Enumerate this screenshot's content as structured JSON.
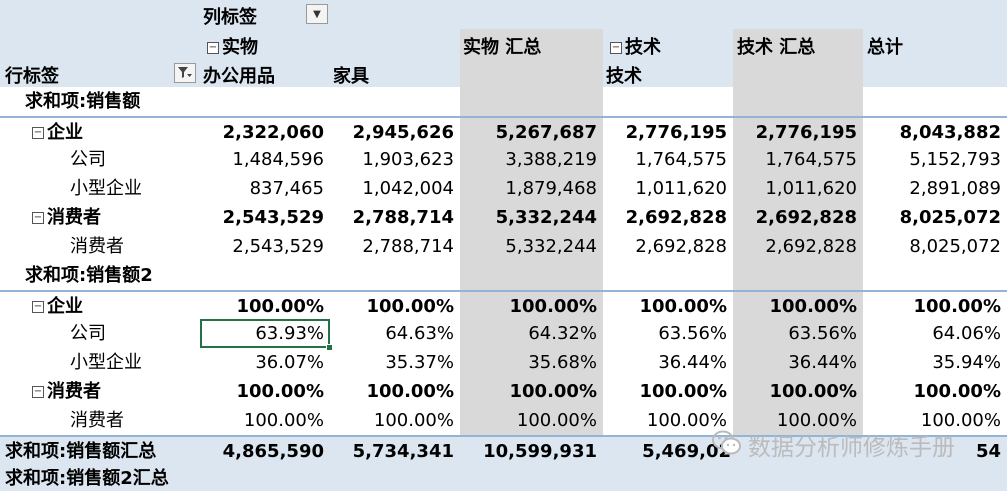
{
  "header": {
    "column_labels": "列标签",
    "row_labels": "行标签",
    "group_physical": "实物",
    "office": "办公用品",
    "furniture": "家具",
    "physical_total": "实物 汇总",
    "group_tech": "技术",
    "tech": "技术",
    "tech_total": "技术 汇总",
    "grand_total": "总计"
  },
  "section1": {
    "title": "求和项:销售额",
    "rows": [
      {
        "label": "企业",
        "level": 1,
        "collapse": true,
        "bold": true,
        "values": [
          "2,322,060",
          "2,945,626",
          "5,267,687",
          "2,776,195",
          "2,776,195",
          "8,043,882"
        ]
      },
      {
        "label": "公司",
        "level": 2,
        "bold": false,
        "values": [
          "1,484,596",
          "1,903,623",
          "3,388,219",
          "1,764,575",
          "1,764,575",
          "5,152,793"
        ]
      },
      {
        "label": "小型企业",
        "level": 2,
        "bold": false,
        "values": [
          "837,465",
          "1,042,004",
          "1,879,468",
          "1,011,620",
          "1,011,620",
          "2,891,089"
        ]
      },
      {
        "label": "消费者",
        "level": 1,
        "collapse": true,
        "bold": true,
        "values": [
          "2,543,529",
          "2,788,714",
          "5,332,244",
          "2,692,828",
          "2,692,828",
          "8,025,072"
        ]
      },
      {
        "label": "消费者",
        "level": 2,
        "bold": false,
        "values": [
          "2,543,529",
          "2,788,714",
          "5,332,244",
          "2,692,828",
          "2,692,828",
          "8,025,072"
        ]
      }
    ]
  },
  "section2": {
    "title": "求和项:销售额2",
    "rows": [
      {
        "label": "企业",
        "level": 1,
        "collapse": true,
        "bold": true,
        "values": [
          "100.00%",
          "100.00%",
          "100.00%",
          "100.00%",
          "100.00%",
          "100.00%"
        ]
      },
      {
        "label": "公司",
        "level": 2,
        "bold": false,
        "values": [
          "63.93%",
          "64.63%",
          "64.32%",
          "63.56%",
          "63.56%",
          "64.06%"
        ]
      },
      {
        "label": "小型企业",
        "level": 2,
        "bold": false,
        "values": [
          "36.07%",
          "35.37%",
          "35.68%",
          "36.44%",
          "36.44%",
          "35.94%"
        ]
      },
      {
        "label": "消费者",
        "level": 1,
        "collapse": true,
        "bold": true,
        "values": [
          "100.00%",
          "100.00%",
          "100.00%",
          "100.00%",
          "100.00%",
          "100.00%"
        ]
      },
      {
        "label": "消费者",
        "level": 2,
        "bold": false,
        "values": [
          "100.00%",
          "100.00%",
          "100.00%",
          "100.00%",
          "100.00%",
          "100.00%"
        ]
      }
    ]
  },
  "grand_total_row": {
    "label": "求和项:销售额汇总",
    "values": [
      "4,865,590",
      "5,734,341",
      "10,599,931",
      "5,469,02",
      "",
      "54"
    ]
  },
  "grand_total_row2": {
    "label": "求和项:销售额2汇总"
  },
  "watermark": {
    "text": "数据分析师修炼手册",
    "icon": "wechat-icon"
  },
  "colors": {
    "header_bg": "#dce6f1",
    "subtotal_column_bg": "#d9d9d9",
    "selection_border": "#217346"
  }
}
